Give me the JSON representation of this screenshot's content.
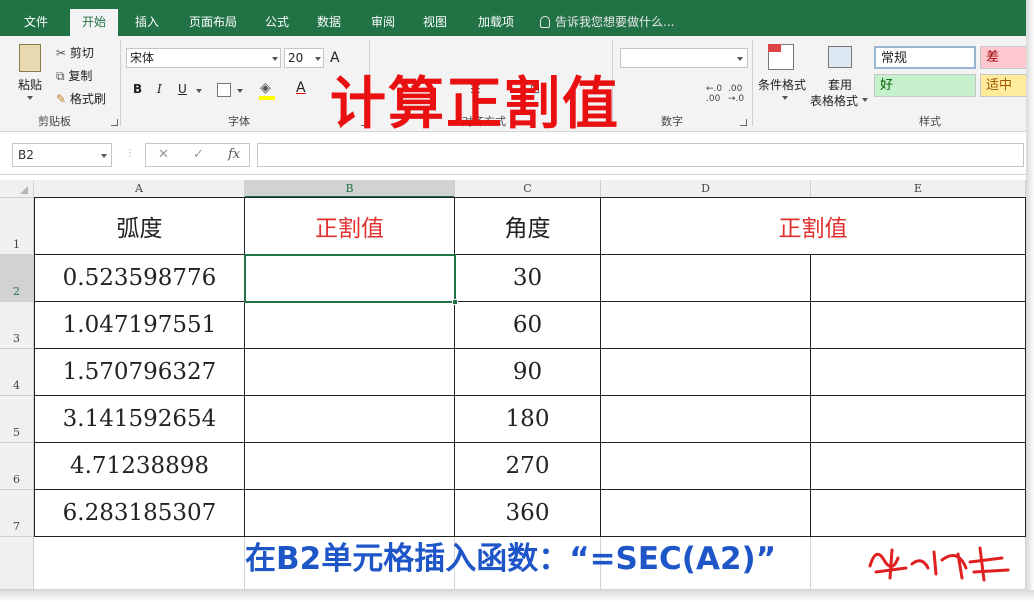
{
  "tabs": [
    {
      "label": "文件"
    },
    {
      "label": "开始"
    },
    {
      "label": "插入"
    },
    {
      "label": "页面布局"
    },
    {
      "label": "公式"
    },
    {
      "label": "数据"
    },
    {
      "label": "审阅"
    },
    {
      "label": "视图"
    },
    {
      "label": "加载项"
    }
  ],
  "tell_me": "告诉我您想要做什么...",
  "ribbon": {
    "clipboard": {
      "paste": "粘贴",
      "cut": "剪切",
      "copy": "复制",
      "format_painter": "格式刷",
      "group": "剪贴板"
    },
    "font": {
      "name": "宋体",
      "size": "20",
      "bold": "B",
      "italic": "I",
      "underline": "U",
      "group": "字体"
    },
    "alignment": {
      "group": "对齐方式"
    },
    "number": {
      "group": "数字"
    },
    "styles": {
      "conditional": "条件格式",
      "table_format_1": "套用",
      "table_format_2": "表格格式",
      "group": "样式",
      "normal": "常规",
      "bad": "差",
      "good": "好",
      "neutral": "适中"
    }
  },
  "title_overlay": "计算正割值",
  "name_box": "B2",
  "formula_bar": {
    "cancel": "✕",
    "enter": "✓",
    "fx": "fx",
    "value": ""
  },
  "columns": [
    "A",
    "B",
    "C",
    "D",
    "E"
  ],
  "rows": [
    "1",
    "2",
    "3",
    "4",
    "5",
    "6",
    "7"
  ],
  "sheet": {
    "header": {
      "A": "弧度",
      "B": "正割值",
      "C": "角度",
      "DE": "正割值"
    },
    "data": [
      {
        "A": "0.523598776",
        "C": "30"
      },
      {
        "A": "1.047197551",
        "C": "60"
      },
      {
        "A": "1.570796327",
        "C": "90"
      },
      {
        "A": "3.141592654",
        "C": "180"
      },
      {
        "A": "4.71238898",
        "C": "270"
      },
      {
        "A": "6.283185307",
        "C": "360"
      }
    ]
  },
  "instruction": "在B2单元格插入函数：“=SEC(A2)”",
  "signature": "赵之峰",
  "colors": {
    "excel_green": "#217346",
    "title_red": "#e81010",
    "instruction_blue": "#1e56c8",
    "header_red": "#e03030"
  }
}
